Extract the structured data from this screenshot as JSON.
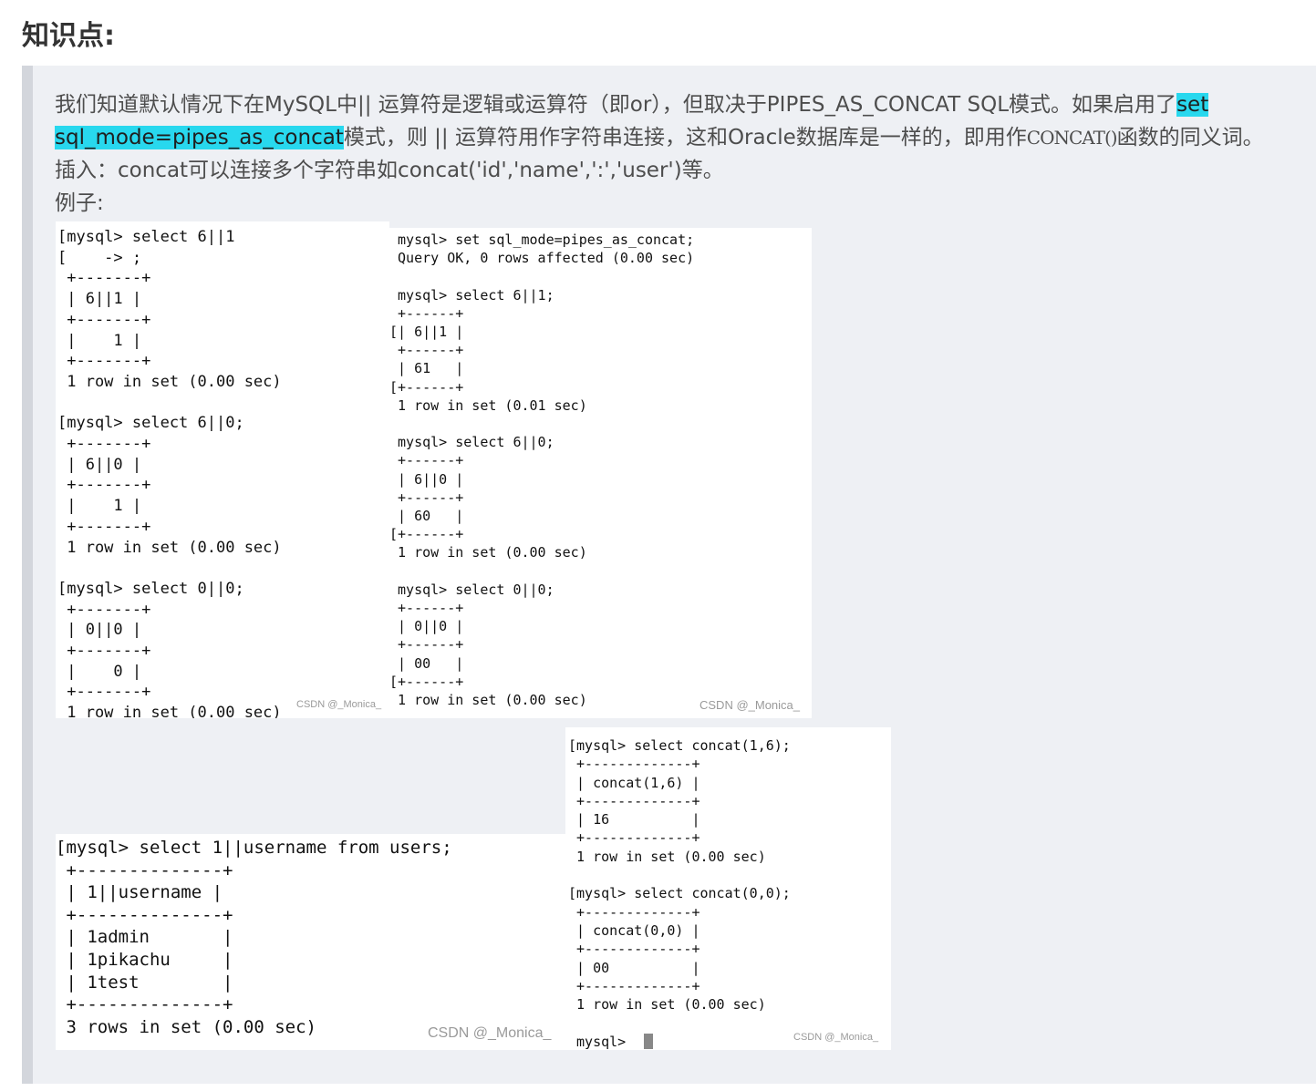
{
  "heading": "知识点:",
  "paragraph": {
    "line1_text": "我们知道默认情况下在MySQL中|| 运算符是逻辑或运算符（即or），但取决于PIPES_AS_CONCAT SQL模式。如果启用了",
    "line1_highlight": "set",
    "line2_highlight": "sql_mode=pipes_as_concat",
    "line2_text_a": "模式，则 || 运算符用作字符串连接，这和Oracle数据库是一样的，即用作",
    "line2_code": "CONCAT()",
    "line2_text_b": "函数的同义词。",
    "line3": "插入：concat可以连接多个字符串如concat('id','name',':','user')等。",
    "line4": "例子:"
  },
  "terminals": {
    "t1": {
      "text": "[mysql> select 6||1\n[    -> ;\n +-------+\n | 6||1 |\n +-------+\n |    1 |\n +-------+\n 1 row in set (0.00 sec)\n\n[mysql> select 6||0;\n +-------+\n | 6||0 |\n +-------+\n |    1 |\n +-------+\n 1 row in set (0.00 sec)\n\n[mysql> select 0||0;\n +-------+\n | 0||0 |\n +-------+\n |    0 |\n +-------+\n 1 row in set (0.00 sec)",
      "watermark": "CSDN @_Monica_"
    },
    "t2": {
      "text": " mysql> set sql_mode=pipes_as_concat;\n Query OK, 0 rows affected (0.00 sec)\n\n mysql> select 6||1;\n +------+\n[| 6||1 |\n +------+\n | 61   |\n[+------+\n 1 row in set (0.01 sec)\n\n mysql> select 6||0;\n +------+\n | 6||0 |\n +------+\n | 60   |\n[+------+\n 1 row in set (0.00 sec)\n\n mysql> select 0||0;\n +------+\n | 0||0 |\n +------+\n | 00   |\n[+------+\n 1 row in set (0.00 sec)",
      "watermark": "CSDN @_Monica_"
    },
    "t3": {
      "text": "[mysql> select 1||username from users;\n +--------------+\n | 1||username |\n +--------------+\n | 1admin       |\n | 1pikachu     |\n | 1test        |\n +--------------+\n 3 rows in set (0.00 sec)",
      "watermark": "CSDN @_Monica_"
    },
    "t4": {
      "text": "[mysql> select concat(1,6);\n +-------------+\n | concat(1,6) |\n +-------------+\n | 16          |\n +-------------+\n 1 row in set (0.00 sec)\n\n[mysql> select concat(0,0);\n +-------------+\n | concat(0,0) |\n +-------------+\n | 00          |\n +-------------+\n 1 row in set (0.00 sec)\n\n mysql>",
      "watermark": "CSDN @_Monica_"
    }
  }
}
